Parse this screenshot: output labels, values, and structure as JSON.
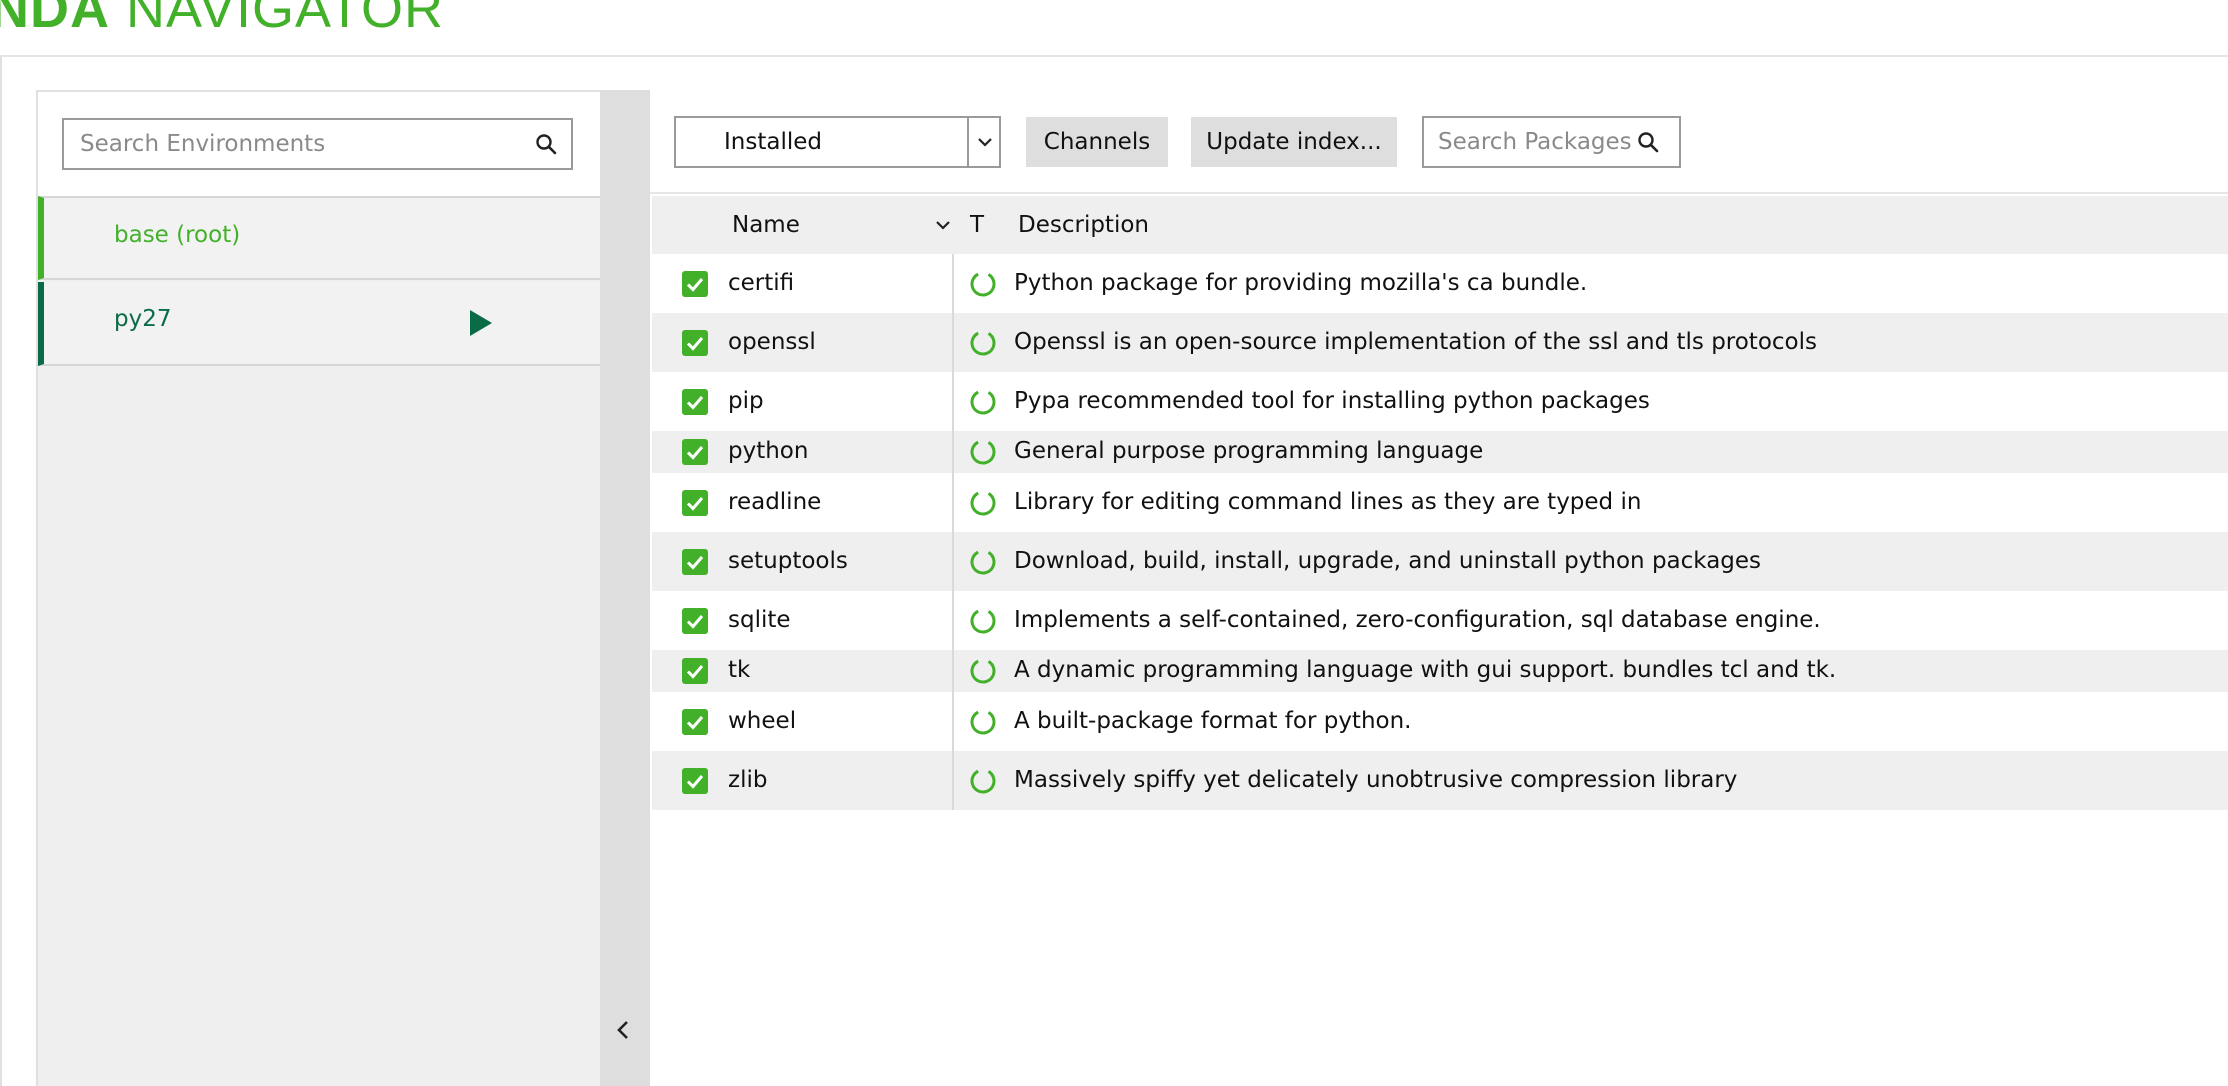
{
  "app": {
    "brand_bold": "NDA",
    "brand_light": " NAVIGATOR"
  },
  "environments": {
    "search_placeholder": "Search Environments",
    "items": [
      {
        "label": "base (root)"
      },
      {
        "label": "py27"
      }
    ]
  },
  "toolbar": {
    "filter_selected": "Installed",
    "channels_label": "Channels",
    "update_label": "Update index...",
    "search_placeholder": "Search Packages"
  },
  "table": {
    "columns": {
      "name": "Name",
      "type": "T",
      "description": "Description"
    },
    "rows": [
      {
        "name": "certifi",
        "description": "Python package for providing mozilla's ca bundle."
      },
      {
        "name": "openssl",
        "description": "Openssl is an open-source implementation of the ssl and tls protocols"
      },
      {
        "name": "pip",
        "description": "Pypa recommended tool for installing python packages"
      },
      {
        "name": "python",
        "description": "General purpose programming language"
      },
      {
        "name": "readline",
        "description": "Library for editing command lines as they are typed in"
      },
      {
        "name": "setuptools",
        "description": "Download, build, install, upgrade, and uninstall python packages"
      },
      {
        "name": "sqlite",
        "description": "Implements a self-contained, zero-configuration, sql database engine."
      },
      {
        "name": "tk",
        "description": "A dynamic programming language with gui support.  bundles tcl and tk."
      },
      {
        "name": "wheel",
        "description": "A built-package format for python."
      },
      {
        "name": "zlib",
        "description": "Massively spiffy yet delicately unobtrusive compression library"
      }
    ]
  },
  "colors": {
    "accent": "#43b02a",
    "dark_accent": "#0a6b47",
    "panel_bg": "#efefef"
  },
  "icons": {
    "search": "search-icon",
    "play": "play-icon",
    "collapse": "chevron-left-icon",
    "status": "status-ring-icon",
    "checkbox": "checkbox-checked-icon"
  }
}
